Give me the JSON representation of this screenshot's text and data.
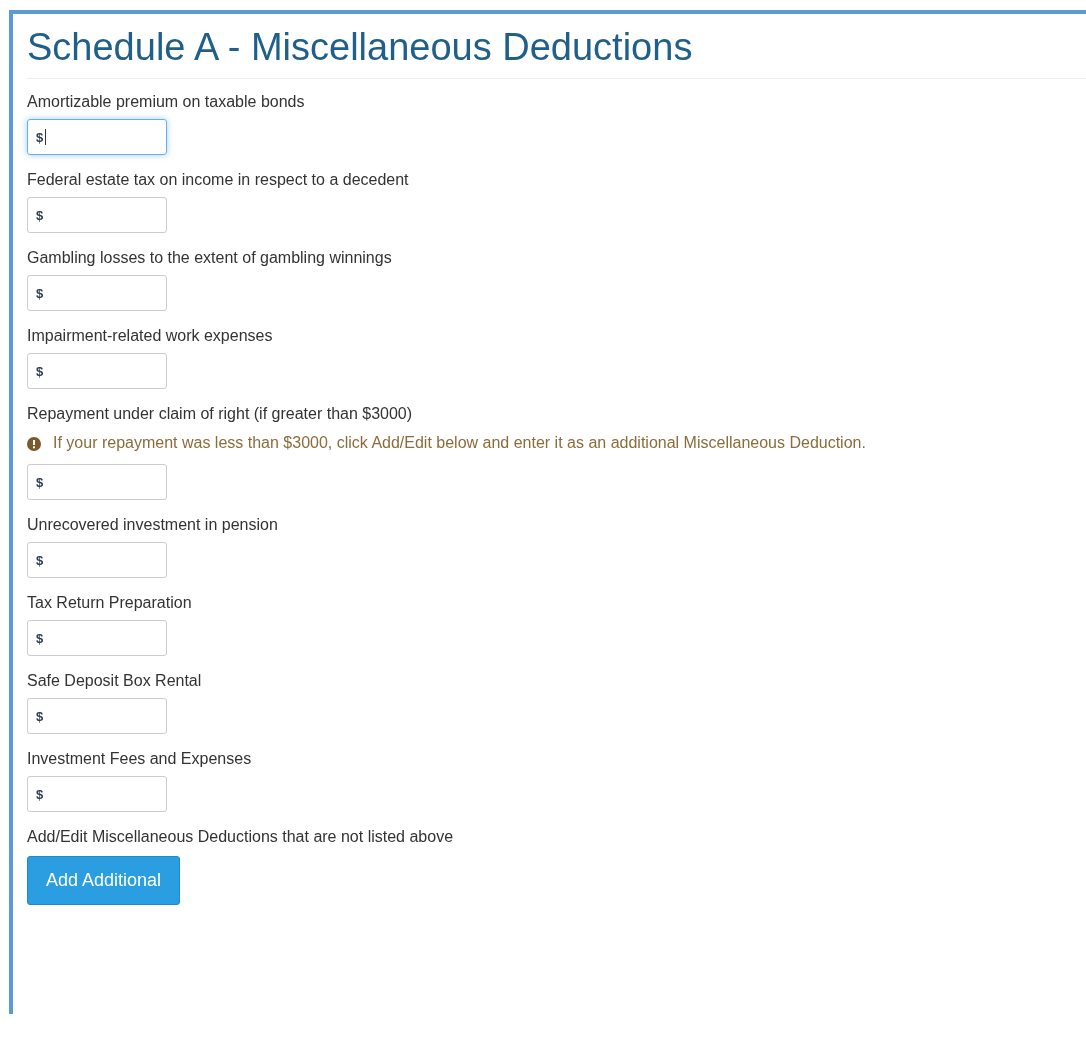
{
  "title": "Schedule A - Miscellaneous Deductions",
  "fields": [
    {
      "label": "Amortizable premium on taxable bonds",
      "prefix": "$",
      "focused": true
    },
    {
      "label": "Federal estate tax on income in respect to a decedent",
      "prefix": "$",
      "focused": false
    },
    {
      "label": "Gambling losses to the extent of gambling winnings",
      "prefix": "$",
      "focused": false
    },
    {
      "label": "Impairment-related work expenses",
      "prefix": "$",
      "focused": false
    },
    {
      "label": "Repayment under claim of right (if greater than $3000)",
      "notice": "If your repayment was less than $3000, click Add/Edit below and enter it as an additional Miscellaneous Deduction.",
      "prefix": "$",
      "focused": false
    },
    {
      "label": "Unrecovered investment in pension",
      "prefix": "$",
      "focused": false
    },
    {
      "label": "Tax Return Preparation",
      "prefix": "$",
      "focused": false
    },
    {
      "label": "Safe Deposit Box Rental",
      "prefix": "$",
      "focused": false
    },
    {
      "label": "Investment Fees and Expenses",
      "prefix": "$",
      "focused": false
    }
  ],
  "additional": {
    "label": "Add/Edit Miscellaneous Deductions that are not listed above",
    "button": "Add Additional"
  }
}
